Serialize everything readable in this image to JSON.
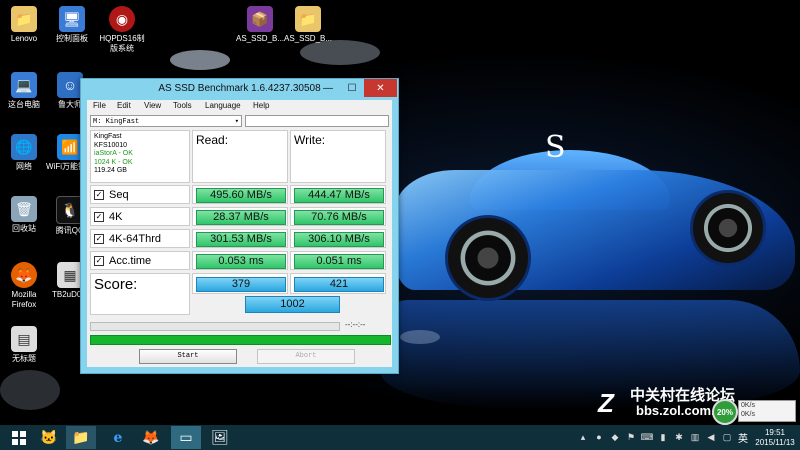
{
  "desktop": {
    "icons": [
      {
        "label": "Lenovo",
        "glyph": "📁"
      },
      {
        "label": "控制面板",
        "glyph": "🖥"
      },
      {
        "label": "HQPDS16制版系统",
        "glyph": "◉"
      },
      {
        "label": "AS_SSD_B...",
        "glyph": "📦"
      },
      {
        "label": "AS_SSD_B...",
        "glyph": "📁"
      },
      {
        "label": "这台电脑",
        "glyph": "💻"
      },
      {
        "label": "鲁大师",
        "glyph": "☺"
      },
      {
        "label": "网络",
        "glyph": "🌐"
      },
      {
        "label": "WiFi万能钥匙",
        "glyph": "📶"
      },
      {
        "label": "回收站",
        "glyph": "🗑"
      },
      {
        "label": "腾讯QQ",
        "glyph": "🐧"
      },
      {
        "label": "Mozilla Firefox",
        "glyph": "🦊"
      },
      {
        "label": "TB2uD0...",
        "glyph": "▦"
      },
      {
        "label": "无标题",
        "glyph": "▤"
      }
    ]
  },
  "window": {
    "title": "AS SSD Benchmark 1.6.4237.30508",
    "minimize": "—",
    "maximize": "☐",
    "close": "✕",
    "menu": [
      "File",
      "Edit",
      "View",
      "Tools",
      "Language",
      "Help"
    ],
    "drive": "M: KingFast",
    "drive_arrow": "▾",
    "info": {
      "model": "KingFast",
      "firmware": "KFS10010",
      "driver": "iaStorA - OK",
      "alignment": "1024 K - OK",
      "size": "119.24 GB"
    },
    "read_header": "Read:",
    "write_header": "Write:",
    "check": "✓",
    "rows": [
      {
        "label": "Seq",
        "read": "495.60 MB/s",
        "write": "444.47 MB/s"
      },
      {
        "label": "4K",
        "read": "28.37 MB/s",
        "write": "70.76 MB/s"
      },
      {
        "label": "4K-64Thrd",
        "read": "301.53 MB/s",
        "write": "306.10 MB/s"
      },
      {
        "label": "Acc.time",
        "read": "0.053 ms",
        "write": "0.051 ms"
      }
    ],
    "score_label": "Score:",
    "score_read": "379",
    "score_write": "421",
    "score_total": "1002",
    "elapsed": "--:--:--",
    "start": "Start",
    "abort": "Abort"
  },
  "watermark": {
    "brand": "中关村在线论坛",
    "url": "bbs.zol.com.cn",
    "logo": "Z"
  },
  "netmeter": {
    "percent": "20%",
    "up": "0K/s",
    "down": "0K/s"
  },
  "taskbar": {
    "ime": "英",
    "time": "19:51",
    "date": "2015/11/13"
  }
}
